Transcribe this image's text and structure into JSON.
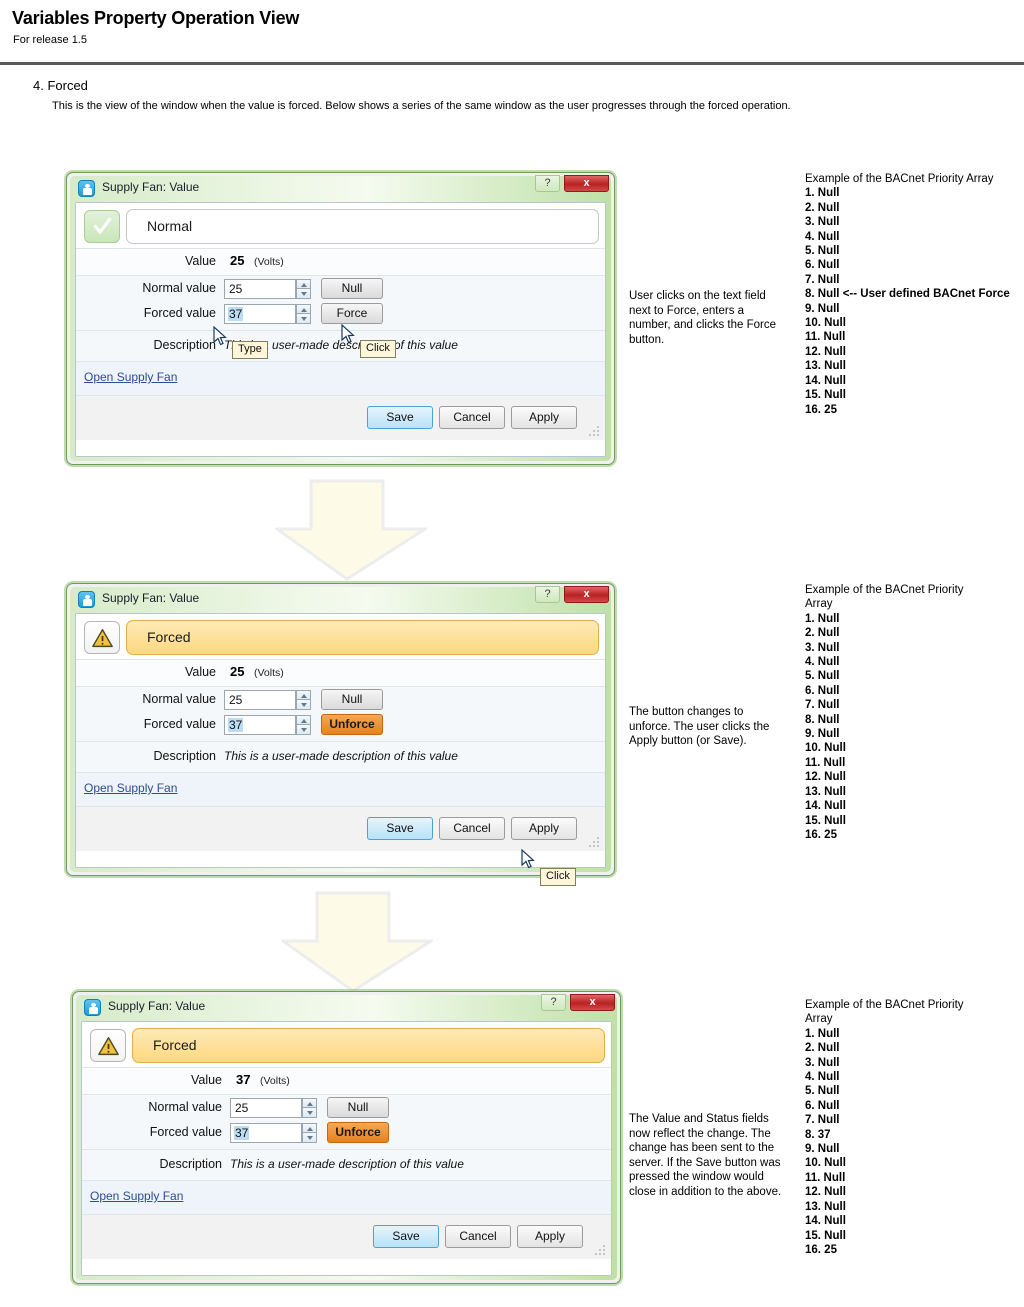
{
  "document": {
    "title": "Variables Property Operation View",
    "subtitle": "For release 1.5",
    "section_number": "4. Forced",
    "section_body": "This is the view of the window when the value is forced. Below shows a series of the same window as the user progresses through the forced operation."
  },
  "colors": {
    "window_border_green": "#6f9e5a",
    "titlebar_green": "#cfe8bd",
    "close_red": "#b92222",
    "forced_amber": "#fdd97f",
    "unforce_orange": "#e8821d",
    "save_blue": "#b9e2f8",
    "link_blue": "#2b4d91",
    "arrow_cream": "#fdfbe8"
  },
  "dialogs": [
    {
      "id": "dialog-normal",
      "icon": "app-icon",
      "title": "Supply Fan: Value",
      "help_label": "?",
      "close_label": "x",
      "status": {
        "icon": "check-icon",
        "text": "Normal",
        "state": "normal"
      },
      "value_label": "Value",
      "value": "25",
      "unit": "(Volts)",
      "normal_label": "Normal value",
      "normal_value": "25",
      "normal_button": "Null",
      "forced_label": "Forced value",
      "forced_value": "37",
      "forced_button": "Force",
      "forced_button_style": "grey",
      "description_label": "Description",
      "description": "This is a user-made description of this value",
      "link": "Open Supply Fan",
      "buttons": {
        "save": "Save",
        "cancel": "Cancel",
        "apply": "Apply"
      },
      "tooltips": [
        {
          "name": "type-tooltip",
          "text": "Type"
        },
        {
          "name": "click-tooltip",
          "text": "Click"
        }
      ]
    },
    {
      "id": "dialog-forced-pending",
      "icon": "app-icon",
      "title": "Supply Fan: Value",
      "help_label": "?",
      "close_label": "x",
      "status": {
        "icon": "warning-icon",
        "text": "Forced",
        "state": "forced"
      },
      "value_label": "Value",
      "value": "25",
      "unit": "(Volts)",
      "normal_label": "Normal value",
      "normal_value": "25",
      "normal_button": "Null",
      "forced_label": "Forced value",
      "forced_value": "37",
      "forced_button": "Unforce",
      "forced_button_style": "orange",
      "description_label": "Description",
      "description": "This is a user-made description of this value",
      "link": "Open Supply Fan",
      "buttons": {
        "save": "Save",
        "cancel": "Cancel",
        "apply": "Apply"
      },
      "tooltips": [
        {
          "name": "click-tooltip",
          "text": "Click"
        }
      ]
    },
    {
      "id": "dialog-forced-applied",
      "icon": "app-icon",
      "title": "Supply Fan: Value",
      "help_label": "?",
      "close_label": "x",
      "status": {
        "icon": "warning-icon",
        "text": "Forced",
        "state": "forced"
      },
      "value_label": "Value",
      "value": "37",
      "unit": "(Volts)",
      "normal_label": "Normal value",
      "normal_value": "25",
      "normal_button": "Null",
      "forced_label": "Forced value",
      "forced_value": "37",
      "forced_button": "Unforce",
      "forced_button_style": "orange",
      "description_label": "Description",
      "description": "This is a user-made description of this value",
      "link": "Open Supply Fan",
      "buttons": {
        "save": "Save",
        "cancel": "Cancel",
        "apply": "Apply"
      },
      "tooltips": []
    }
  ],
  "notes": [
    {
      "id": "note-1",
      "text": "User clicks on the text field next to Force, enters a number, and clicks the Force button."
    },
    {
      "id": "note-2",
      "text": "The button changes to unforce. The user clicks the Apply button (or Save)."
    },
    {
      "id": "note-3",
      "text": "The Value and Status fields now reflect the change. The change has been sent to the server. If the Save button was pressed the window would close in addition to the above."
    }
  ],
  "priority_arrays": [
    {
      "id": "priority-array-1",
      "heading": "Example of the BACnet Priority Array",
      "items": [
        "1. Null",
        "2. Null",
        "3. Null",
        "4. Null",
        "5. Null",
        "6. Null",
        "7. Null",
        "8. Null <-- User defined BACnet Force",
        "9. Null",
        "10. Null",
        "11. Null",
        "12. Null",
        "13. Null",
        "14. Null",
        "15. Null",
        "16. 25"
      ]
    },
    {
      "id": "priority-array-2",
      "heading": "Example of the BACnet Priority Array",
      "items": [
        "1. Null",
        "2. Null",
        "3. Null",
        "4. Null",
        "5. Null",
        "6. Null",
        "7. Null",
        "8. Null",
        "9. Null",
        "10. Null",
        "11. Null",
        "12. Null",
        "13. Null",
        "14. Null",
        "15. Null",
        "16. 25"
      ]
    },
    {
      "id": "priority-array-3",
      "heading": "Example of the BACnet Priority Array",
      "items": [
        "1. Null",
        "2. Null",
        "3. Null",
        "4. Null",
        "5. Null",
        "6. Null",
        "7. Null",
        "8. 37",
        "9. Null",
        "10. Null",
        "11. Null",
        "12. Null",
        "13. Null",
        "14. Null",
        "15. Null",
        "16. 25"
      ]
    }
  ]
}
